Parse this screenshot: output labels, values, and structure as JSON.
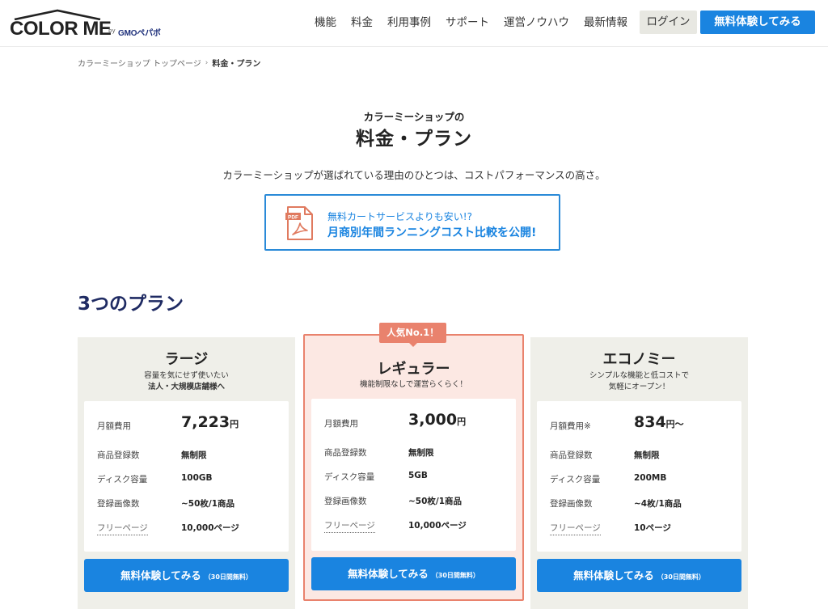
{
  "header": {
    "logo_text": "COLOR ME",
    "logo_by": "by",
    "logo_company": "GMOペパボ",
    "nav": [
      "機能",
      "料金",
      "利用事例",
      "サポート",
      "運営ノウハウ",
      "最新情報"
    ],
    "login_label": "ログイン",
    "trial_label": "無料体験してみる"
  },
  "breadcrumb": {
    "home": "カラーミーショップ トップページ",
    "current": "料金・プラン"
  },
  "page": {
    "pre_title": "カラーミーショップの",
    "title": "料金・プラン",
    "lead": "カラーミーショップが選ばれている理由のひとつは、コストパフォーマンスの高さ。"
  },
  "pdf_banner": {
    "icon_label": "PDF",
    "line1": "無料カートサービスよりも安い!?",
    "line2": "月商別年間ランニングコスト比較を公開!"
  },
  "section_title": "3つのプラン",
  "labels": {
    "monthly": "月額費用",
    "monthly_econ": "月額費用※",
    "products": "商品登録数",
    "disk": "ディスク容量",
    "images": "登録画像数",
    "free_pages": "フリーページ",
    "cta": "無料体験してみる",
    "cta_note": "（30日間無料）",
    "yen": "円",
    "yen_from": "円〜"
  },
  "plans": {
    "large": {
      "name": "ラージ",
      "desc1": "容量を気にせず使いたい",
      "desc2": "法人・大規模店舗様へ",
      "price": "7,223",
      "products": "無制限",
      "disk": "100GB",
      "images": "~50枚/1商品",
      "free_pages": "10,000ページ"
    },
    "regular": {
      "badge": "人気No.1！",
      "name": "レギュラー",
      "desc1": "機能制限なしで運営らくらく！",
      "price": "3,000",
      "products": "無制限",
      "disk": "5GB",
      "images": "~50枚/1商品",
      "free_pages": "10,000ページ"
    },
    "economy": {
      "name": "エコノミー",
      "desc1": "シンプルな機能と低コストで",
      "desc2": "気軽にオープン！",
      "price": "834",
      "products": "無制限",
      "disk": "200MB",
      "images": "~4枚/1商品",
      "free_pages": "10ページ"
    }
  },
  "colors": {
    "accent_blue": "#1a84e0",
    "regular_accent": "#e9826d",
    "regular_bg": "#fce8e3",
    "card_bg": "#efefe9",
    "section_title": "#1f2b63"
  }
}
